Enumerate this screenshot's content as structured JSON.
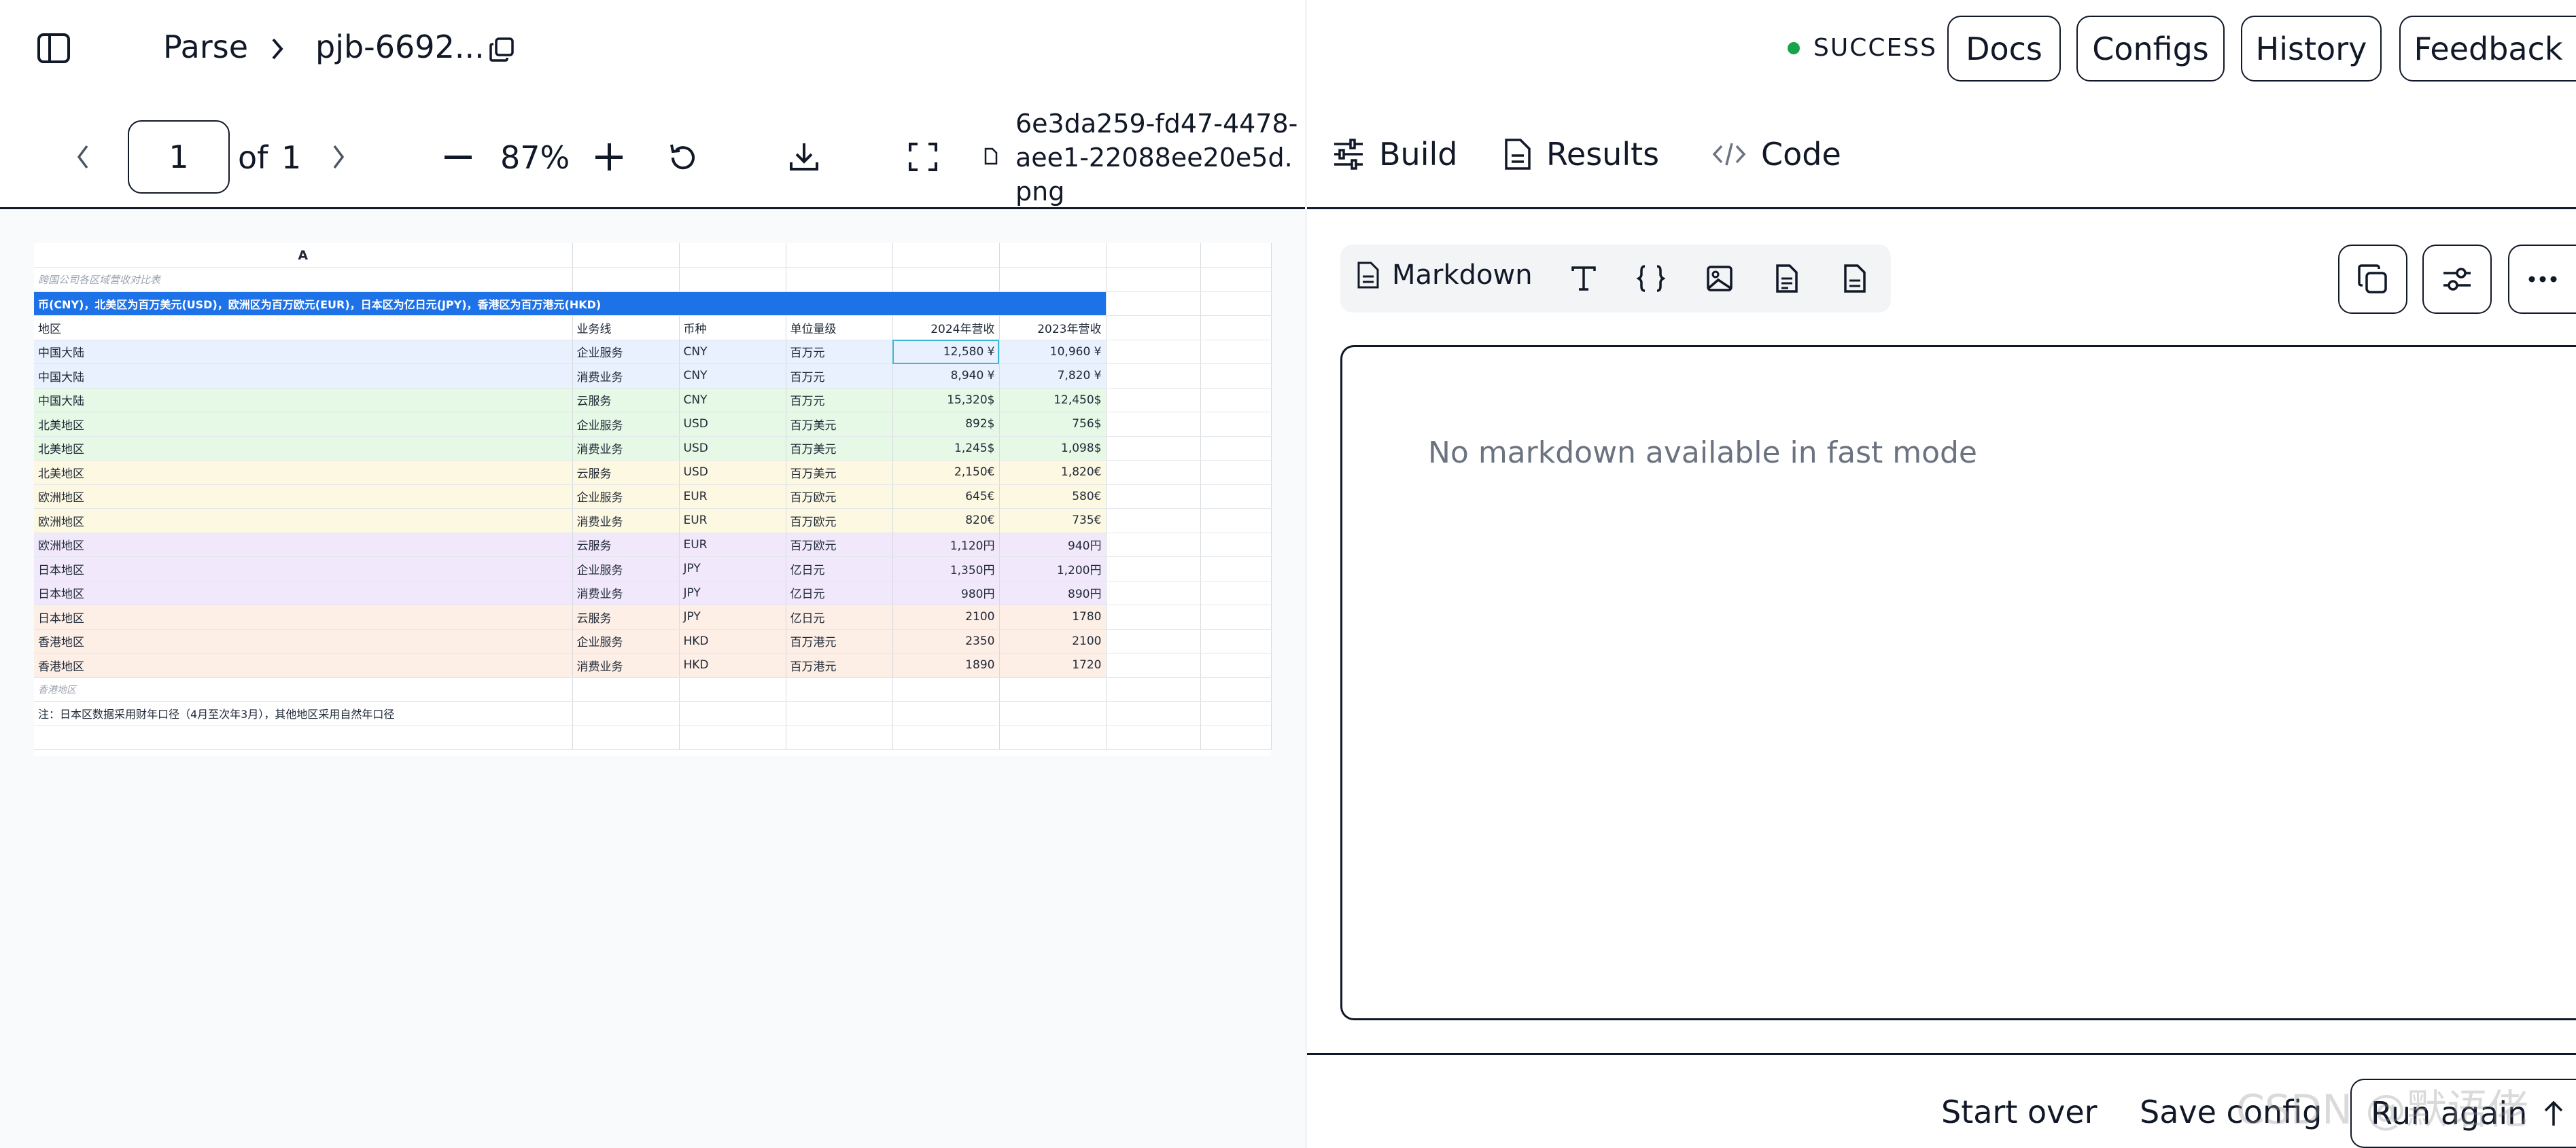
{
  "header": {
    "breadcrumb": {
      "root": "Parse",
      "separator": "›",
      "job": "pjb-6692..."
    },
    "status": "SUCCESS",
    "status_color": "#16a34a",
    "buttons": {
      "docs": "Docs",
      "configs": "Configs",
      "history": "History",
      "feedback": "Feedback"
    }
  },
  "viewer": {
    "page_current": "1",
    "page_of": "of",
    "page_total": "1",
    "zoom": "87%",
    "filename": "6e3da259-fd47-4478-aee1-22088ee20e5d.png"
  },
  "sheet": {
    "column_letter": "A",
    "title": "跨国公司各区域营收对比表",
    "banner": "币(CNY)，北美区为百万美元(USD)，欧洲区为百万欧元(EUR)，日本区为亿日元(JPY)，香港区为百万港元(HKD)",
    "headers": [
      "地区",
      "业务线",
      "币种",
      "单位量级",
      "2024年营收",
      "2023年营收"
    ],
    "rows": [
      {
        "region": "中国大陆",
        "line": "企业服务",
        "currency": "CNY",
        "unit": "百万元",
        "y2024": "12,580 ¥",
        "y2023": "10,960 ¥",
        "color": "blue"
      },
      {
        "region": "中国大陆",
        "line": "消费业务",
        "currency": "CNY",
        "unit": "百万元",
        "y2024": "8,940 ¥",
        "y2023": "7,820 ¥",
        "color": "blue"
      },
      {
        "region": "中国大陆",
        "line": "云服务",
        "currency": "CNY",
        "unit": "百万元",
        "y2024": "15,320$",
        "y2023": "12,450$",
        "color": "green"
      },
      {
        "region": "北美地区",
        "line": "企业服务",
        "currency": "USD",
        "unit": "百万美元",
        "y2024": "892$",
        "y2023": "756$",
        "color": "green"
      },
      {
        "region": "北美地区",
        "line": "消费业务",
        "currency": "USD",
        "unit": "百万美元",
        "y2024": "1,245$",
        "y2023": "1,098$",
        "color": "green"
      },
      {
        "region": "北美地区",
        "line": "云服务",
        "currency": "USD",
        "unit": "百万美元",
        "y2024": "2,150€",
        "y2023": "1,820€",
        "color": "yellow"
      },
      {
        "region": "欧洲地区",
        "line": "企业服务",
        "currency": "EUR",
        "unit": "百万欧元",
        "y2024": "645€",
        "y2023": "580€",
        "color": "yellow"
      },
      {
        "region": "欧洲地区",
        "line": "消费业务",
        "currency": "EUR",
        "unit": "百万欧元",
        "y2024": "820€",
        "y2023": "735€",
        "color": "yellow"
      },
      {
        "region": "欧洲地区",
        "line": "云服务",
        "currency": "EUR",
        "unit": "百万欧元",
        "y2024": "1,120円",
        "y2023": "940円",
        "color": "purple"
      },
      {
        "region": "日本地区",
        "line": "企业服务",
        "currency": "JPY",
        "unit": "亿日元",
        "y2024": "1,350円",
        "y2023": "1,200円",
        "color": "purple"
      },
      {
        "region": "日本地区",
        "line": "消费业务",
        "currency": "JPY",
        "unit": "亿日元",
        "y2024": "980円",
        "y2023": "890円",
        "color": "purple"
      },
      {
        "region": "日本地区",
        "line": "云服务",
        "currency": "JPY",
        "unit": "亿日元",
        "y2024": "2100",
        "y2023": "1780",
        "color": "peach"
      },
      {
        "region": "香港地区",
        "line": "企业服务",
        "currency": "HKD",
        "unit": "百万港元",
        "y2024": "2350",
        "y2023": "2100",
        "color": "peach"
      },
      {
        "region": "香港地区",
        "line": "消费业务",
        "currency": "HKD",
        "unit": "百万港元",
        "y2024": "1890",
        "y2023": "1720",
        "color": "peach"
      }
    ],
    "faded_row": "香港地区",
    "note": "注：日本区数据采用财年口径（4月至次年3月），其他地区采用自然年口径"
  },
  "right": {
    "tabs": {
      "build": "Build",
      "results": "Results",
      "code": "Code"
    },
    "format_label": "Markdown",
    "empty_message": "No markdown available in fast mode",
    "footer": {
      "start_over": "Start over",
      "save_config": "Save config",
      "run_again": "Run again"
    },
    "watermark": "CSDN @默语佬"
  },
  "colors": {
    "banner": "#1d72e8",
    "row_blue": "#e8f1fd",
    "row_green": "#e6f8e6",
    "row_yellow": "#fdf8e1",
    "row_purple": "#f1e8fb",
    "row_peach": "#fdeee6"
  },
  "icons": [
    "sidebar-toggle-icon",
    "chevron-right-icon",
    "copy-icon",
    "chevron-left-icon",
    "minus-icon",
    "plus-icon",
    "rotate-icon",
    "download-icon",
    "fullscreen-icon",
    "file-icon",
    "sliders-icon",
    "document-icon",
    "code-icon",
    "text-icon",
    "braces-icon",
    "image-icon",
    "file-text-icon",
    "page-icon",
    "duplicate-icon",
    "settings-icon",
    "more-icon",
    "arrow-up-icon"
  ]
}
